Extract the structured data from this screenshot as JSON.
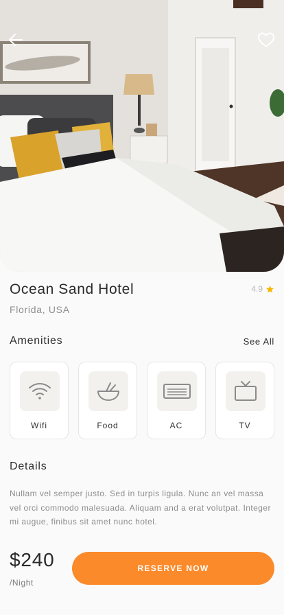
{
  "hotel": {
    "name": "Ocean Sand Hotel",
    "location": "Florida, USA",
    "rating": "4.9"
  },
  "amenities_section": {
    "title": "Amenities",
    "see_all": "See All",
    "items": [
      {
        "label": "Wifi",
        "icon": "wifi-icon"
      },
      {
        "label": "Food",
        "icon": "food-bowl-icon"
      },
      {
        "label": "AC",
        "icon": "air-conditioner-icon"
      },
      {
        "label": "TV",
        "icon": "tv-icon"
      }
    ]
  },
  "details_section": {
    "title": "Details",
    "text": "Nullam vel semper justo. Sed in turpis ligula. Nunc an vel massa vel orci commodo malesuada. Aliquam and a erat volutpat. Integer mi augue, finibus sit amet nunc hotel."
  },
  "booking": {
    "price": "$240",
    "per": "/Night",
    "reserve_label": "RESERVE NOW"
  },
  "colors": {
    "accent": "#fb8a2b",
    "star": "#f5b700",
    "icon_box": "#f3f1ee"
  },
  "icons": {
    "back": "arrow-left-icon",
    "favorite": "heart-outline-icon",
    "rating": "star-icon"
  }
}
